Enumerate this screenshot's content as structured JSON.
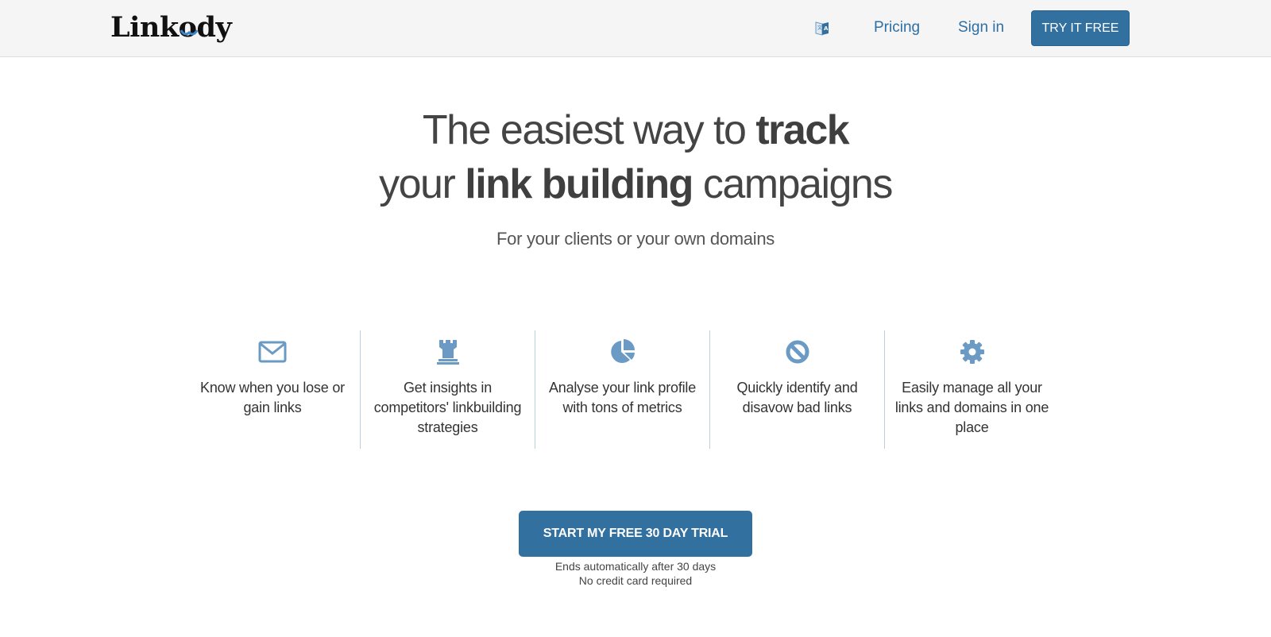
{
  "header": {
    "logo_text": "Linkody",
    "language_icon": "translate-icon",
    "nav_links": [
      {
        "label": "Pricing"
      },
      {
        "label": "Sign in"
      }
    ],
    "try_button_label": "TRY IT FREE"
  },
  "hero": {
    "line1_regular": "The easiest way to ",
    "line1_bold": "track",
    "line2_regular_1": "your ",
    "line2_bold": "link building",
    "line2_regular_2": " campaigns",
    "subtitle": "For your clients or your own domains"
  },
  "features": [
    {
      "icon": "envelope-icon",
      "text": "Know when you lose or gain links"
    },
    {
      "icon": "chess-rook-icon",
      "text": "Get insights in competitors' linkbuilding strategies"
    },
    {
      "icon": "pie-chart-icon",
      "text": "Analyse your link profile with tons of metrics"
    },
    {
      "icon": "ban-icon",
      "text": "Quickly identify and disavow bad links"
    },
    {
      "icon": "gear-icon",
      "text": "Easily manage all your links and domains in one place"
    }
  ],
  "cta": {
    "button_label": "START MY FREE 30 DAY TRIAL",
    "note_line1": "Ends automatically after 30 days",
    "note_line2": "No credit card required"
  },
  "colors": {
    "brand_blue": "#3270a0",
    "link_blue": "#2e6fa3",
    "icon_blue": "#6b9ac4",
    "divider": "#b7d0e2"
  }
}
